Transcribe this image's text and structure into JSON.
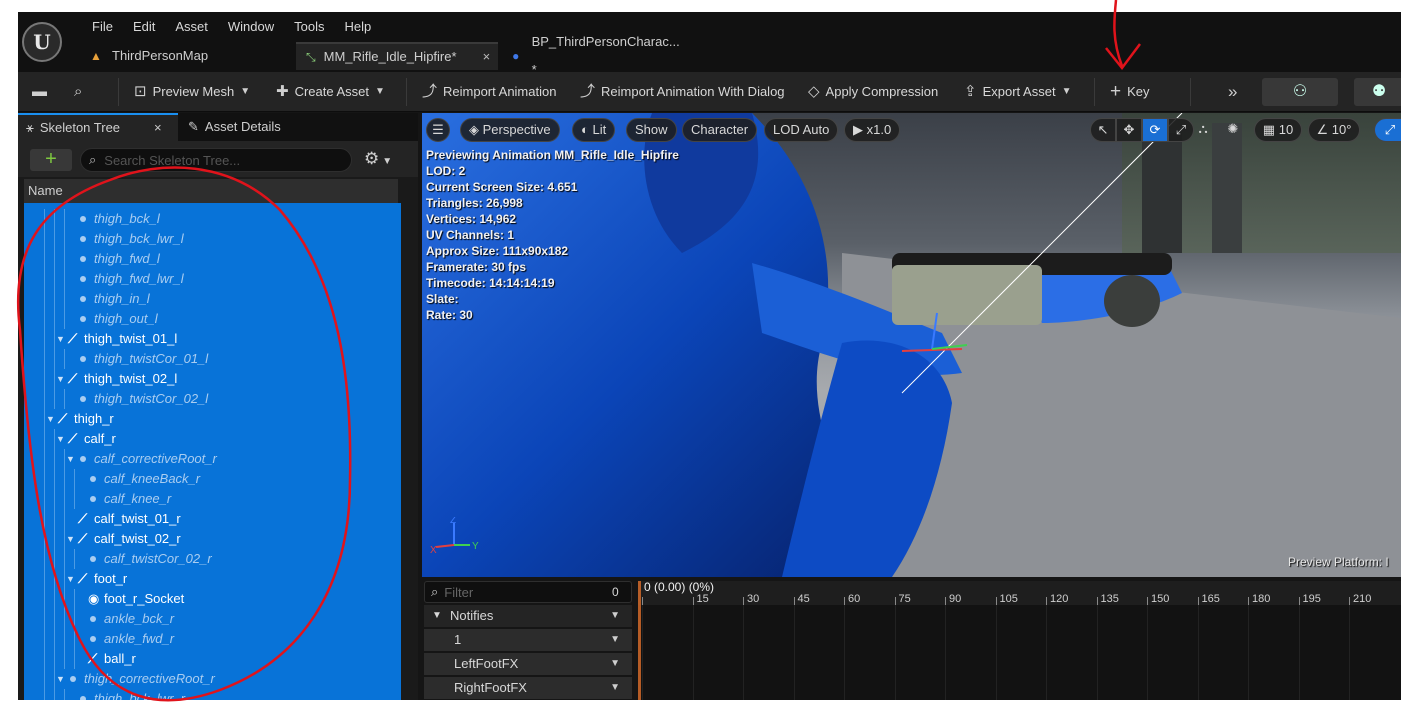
{
  "menu": [
    "File",
    "Edit",
    "Asset",
    "Window",
    "Tools",
    "Help"
  ],
  "doc_tabs": [
    {
      "label": "ThirdPersonMap",
      "icon": "map-icon"
    },
    {
      "label": "MM_Rifle_Idle_Hipfire*",
      "icon": "animation-icon",
      "close": "×"
    },
    {
      "label": "BP_ThirdPersonCharac... *",
      "icon": "blueprint-pawn-icon"
    }
  ],
  "toolbar": {
    "preview_mesh": "Preview Mesh",
    "create_asset": "Create Asset",
    "reimport": "Reimport Animation",
    "reimport_dialog": "Reimport Animation With Dialog",
    "apply_compression": "Apply Compression",
    "export_asset": "Export Asset",
    "key": "Key"
  },
  "left_panel": {
    "tab_skeleton": "Skeleton Tree",
    "tab_close": "×",
    "tab_details": "Asset Details",
    "add_label": "+",
    "search_placeholder": "Search Skeleton Tree...",
    "name_header": "Name"
  },
  "tree": [
    {
      "label": "thigh_bck_l",
      "kind": "socket",
      "depth": 3
    },
    {
      "label": "thigh_bck_lwr_l",
      "kind": "socket",
      "depth": 3
    },
    {
      "label": "thigh_fwd_l",
      "kind": "socket",
      "depth": 3
    },
    {
      "label": "thigh_fwd_lwr_l",
      "kind": "socket",
      "depth": 3
    },
    {
      "label": "thigh_in_l",
      "kind": "socket",
      "depth": 3
    },
    {
      "label": "thigh_out_l",
      "kind": "socket",
      "depth": 3
    },
    {
      "label": "thigh_twist_01_l",
      "kind": "bone",
      "depth": 2,
      "expand": true
    },
    {
      "label": "thigh_twistCor_01_l",
      "kind": "socket",
      "depth": 3
    },
    {
      "label": "thigh_twist_02_l",
      "kind": "bone",
      "depth": 2,
      "expand": true
    },
    {
      "label": "thigh_twistCor_02_l",
      "kind": "socket",
      "depth": 3
    },
    {
      "label": "thigh_r",
      "kind": "bone",
      "depth": 1,
      "expand": true
    },
    {
      "label": "calf_r",
      "kind": "bone",
      "depth": 2,
      "expand": true
    },
    {
      "label": "calf_correctiveRoot_r",
      "kind": "socket",
      "depth": 3,
      "expand": true
    },
    {
      "label": "calf_kneeBack_r",
      "kind": "socket",
      "depth": 4
    },
    {
      "label": "calf_knee_r",
      "kind": "socket",
      "depth": 4
    },
    {
      "label": "calf_twist_01_r",
      "kind": "bone",
      "depth": 3
    },
    {
      "label": "calf_twist_02_r",
      "kind": "bone",
      "depth": 3,
      "expand": true
    },
    {
      "label": "calf_twistCor_02_r",
      "kind": "socket",
      "depth": 4
    },
    {
      "label": "foot_r",
      "kind": "bone",
      "depth": 3,
      "expand": true
    },
    {
      "label": "foot_r_Socket",
      "kind": "attach",
      "depth": 4
    },
    {
      "label": "ankle_bck_r",
      "kind": "socket",
      "depth": 4
    },
    {
      "label": "ankle_fwd_r",
      "kind": "socket",
      "depth": 4
    },
    {
      "label": "ball_r",
      "kind": "bone",
      "depth": 4
    },
    {
      "label": "thigh_correctiveRoot_r",
      "kind": "socket",
      "depth": 2,
      "expand": true
    },
    {
      "label": "thigh_bck_lwr_r",
      "kind": "socket",
      "depth": 3
    }
  ],
  "viewport": {
    "perspective": "Perspective",
    "lit": "Lit",
    "show": "Show",
    "character": "Character",
    "lod": "LOD Auto",
    "speed": "x1.0",
    "grid_snap": "10",
    "angle_snap": "10°",
    "stats": [
      "Previewing Animation MM_Rifle_Idle_Hipfire",
      "LOD: 2",
      "Current Screen Size: 4.651",
      "Triangles: 26,998",
      "Vertices: 14,962",
      "UV Channels: 1",
      "Approx Size: 111x90x182",
      "Framerate: 30 fps",
      "Timecode: 14:14:14:19",
      "Slate:",
      "Rate: 30"
    ],
    "axis_z": "Z",
    "axis_y": "Y",
    "axis_x": "X",
    "preview_platform": "Preview Platform: I"
  },
  "timeline": {
    "filter_placeholder": "Filter",
    "count": "0",
    "tracks": [
      "Notifies",
      "1",
      "LeftFootFX",
      "RightFootFX"
    ],
    "current_time": "0 (0.00) (0%)",
    "ticks": [
      "0",
      "15",
      "30",
      "45",
      "60",
      "75",
      "90",
      "105",
      "120",
      "135",
      "150",
      "165",
      "180",
      "195",
      "210"
    ]
  },
  "colors": {
    "selection_blue": "#0873d8",
    "annotation_red": "#e0131b",
    "accent_blue": "#1a8ff0"
  }
}
